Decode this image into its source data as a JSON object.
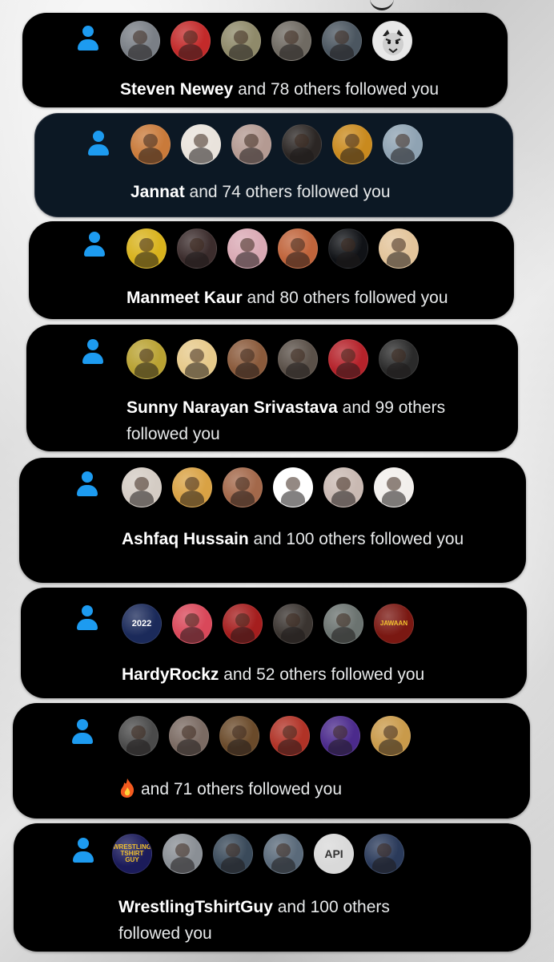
{
  "notifications": [
    {
      "name": "Steven Newey",
      "rest": " and 78 others followed you",
      "avatars": [
        {
          "icon": "avatar-photo",
          "color": "#7a7f86"
        },
        {
          "icon": "avatar-photo",
          "color": "#c32a2a"
        },
        {
          "icon": "avatar-photo",
          "color": "#8f8a6a"
        },
        {
          "icon": "avatar-photo",
          "color": "#6f6a62"
        },
        {
          "icon": "avatar-photo",
          "color": "#4b5660"
        },
        {
          "icon": "tiger-icon",
          "color": "#d8d8d8"
        }
      ]
    },
    {
      "name": "Jannat",
      "rest": " and 74 others followed you",
      "avatars": [
        {
          "icon": "avatar-photo",
          "color": "#c97a3a"
        },
        {
          "icon": "avatar-photo",
          "color": "#e9e3dc"
        },
        {
          "icon": "avatar-photo",
          "color": "#b49a92"
        },
        {
          "icon": "avatar-photo",
          "color": "#2b2624"
        },
        {
          "icon": "avatar-photo",
          "color": "#c98a1e"
        },
        {
          "icon": "avatar-photo",
          "color": "#8fa3b3"
        }
      ]
    },
    {
      "name": "Manmeet Kaur",
      "rest": " and 80 others followed you",
      "avatars": [
        {
          "icon": "avatar-photo",
          "color": "#d8b21c"
        },
        {
          "icon": "avatar-photo",
          "color": "#3b2c2c"
        },
        {
          "icon": "avatar-photo",
          "color": "#d9a9b4"
        },
        {
          "icon": "avatar-photo",
          "color": "#c0643b"
        },
        {
          "icon": "avatar-photo",
          "color": "#101216"
        },
        {
          "icon": "avatar-photo",
          "color": "#e3c49a"
        }
      ]
    },
    {
      "name": "Sunny Narayan Srivastava",
      "rest": " and 99 others followed you",
      "avatars": [
        {
          "icon": "avatar-photo",
          "color": "#b9a232"
        },
        {
          "icon": "avatar-photo",
          "color": "#e6c98a"
        },
        {
          "icon": "avatar-photo",
          "color": "#8a5a3b"
        },
        {
          "icon": "avatar-photo",
          "color": "#5a5048"
        },
        {
          "icon": "avatar-photo",
          "color": "#b5222a"
        },
        {
          "icon": "avatar-photo",
          "color": "#2a2a2a"
        }
      ]
    },
    {
      "name": "Ashfaq Hussain",
      "rest": " and 100 others followed you",
      "avatars": [
        {
          "icon": "avatar-photo",
          "color": "#d4ccc4"
        },
        {
          "icon": "avatar-photo",
          "color": "#d9a244"
        },
        {
          "icon": "avatar-photo",
          "color": "#a3684a"
        },
        {
          "icon": "avatar-photo",
          "color": "#ffffff"
        },
        {
          "icon": "avatar-photo",
          "color": "#c9b9b2"
        },
        {
          "icon": "avatar-photo",
          "color": "#f2efec"
        }
      ]
    },
    {
      "name": "HardyRockz",
      "rest": " and 52 others followed you",
      "avatars": [
        {
          "icon": "new-year-icon",
          "color": "#1b2a5a",
          "text": "2022"
        },
        {
          "icon": "avatar-photo",
          "color": "#d9485a"
        },
        {
          "icon": "avatar-photo",
          "color": "#a51e1e"
        },
        {
          "icon": "avatar-photo",
          "color": "#3a3430"
        },
        {
          "icon": "avatar-photo",
          "color": "#6b7370"
        },
        {
          "icon": "movie-poster-icon",
          "color": "#7a1812",
          "text": "JAWAAN"
        }
      ]
    },
    {
      "emoji": "🔥",
      "name": "",
      "rest": "and 71 others followed you",
      "avatars": [
        {
          "icon": "avatar-photo",
          "color": "#4a4a4a"
        },
        {
          "icon": "avatar-photo",
          "color": "#7a6a62"
        },
        {
          "icon": "avatar-photo",
          "color": "#6a4a2a"
        },
        {
          "icon": "avatar-photo",
          "color": "#b03226"
        },
        {
          "icon": "avatar-photo",
          "color": "#4b2a8c"
        },
        {
          "icon": "avatar-photo",
          "color": "#c99a4a"
        }
      ]
    },
    {
      "name": "WrestlingTshirtGuy",
      "rest": " and 100 others followed you",
      "avatars": [
        {
          "icon": "wrestling-logo-icon",
          "color": "#1b1b5a",
          "text": "WRESTLING TSHIRT GUY"
        },
        {
          "icon": "avatar-photo",
          "color": "#8a8f95"
        },
        {
          "icon": "avatar-photo",
          "color": "#3a4a5a"
        },
        {
          "icon": "avatar-photo",
          "color": "#5a6a7a"
        },
        {
          "icon": "api-logo-icon",
          "color": "#d9d9d9",
          "text": "API"
        },
        {
          "icon": "avatar-photo",
          "color": "#2a3a5a"
        }
      ]
    }
  ]
}
